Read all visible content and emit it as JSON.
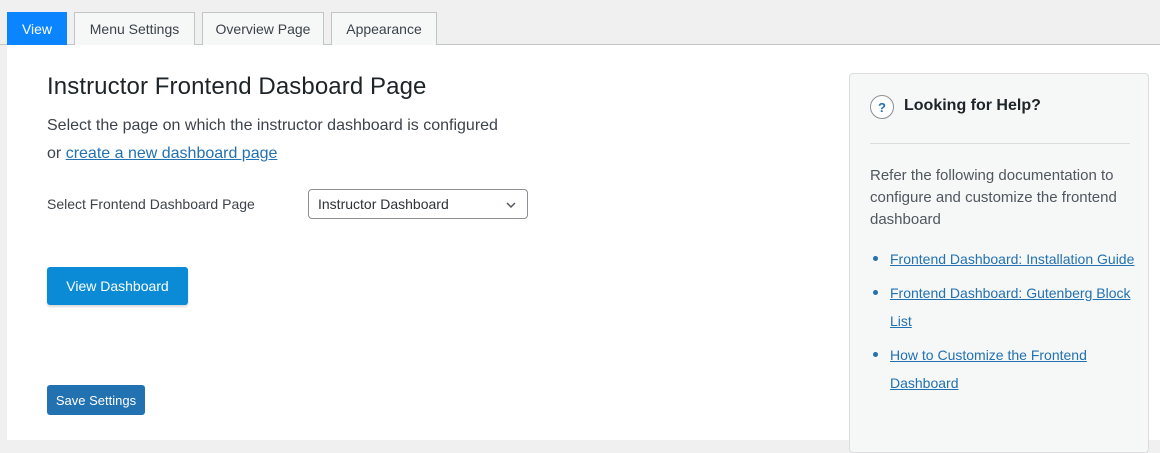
{
  "tabs": [
    {
      "label": "View",
      "active": true
    },
    {
      "label": "Menu Settings",
      "active": false
    },
    {
      "label": "Overview Page",
      "active": false
    },
    {
      "label": "Appearance",
      "active": false
    }
  ],
  "main": {
    "title": "Instructor Frontend Dasboard Page",
    "description": "Select the page on which the instructor dashboard is configured",
    "or_text": "or",
    "create_link": "create a new dashboard page",
    "select_label": "Select Frontend Dashboard Page",
    "select_value": "Instructor Dashboard",
    "view_button": "View Dashboard",
    "save_button": "Save Settings"
  },
  "help": {
    "title": "Looking for Help?",
    "icon": "question-icon",
    "icon_glyph": "?",
    "text": "Refer the following documentation to configure and customize the frontend dashboard",
    "links": [
      "Frontend Dashboard: Installation Guide",
      "Frontend Dashboard: Gutenberg Block List",
      "How to Customize the Frontend Dashboard"
    ]
  },
  "colors": {
    "active_tab": "#0a84ff",
    "primary_button": "#0b8ad6",
    "save_button": "#2271b1",
    "link": "#2271b1"
  }
}
